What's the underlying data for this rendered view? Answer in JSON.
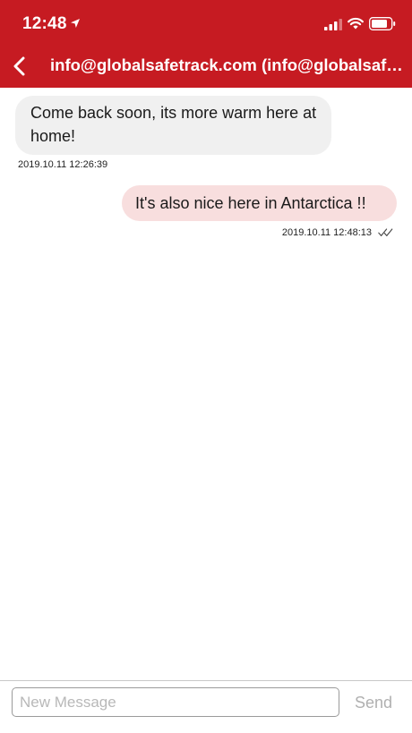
{
  "status_bar": {
    "time": "12:48",
    "location_icon": "location-arrow-icon",
    "signal_icon": "cellular-signal-icon",
    "wifi_icon": "wifi-icon",
    "battery_icon": "battery-icon"
  },
  "header": {
    "title": "info@globalsafetrack.com (info@globalsafetrack.com)",
    "back_icon": "chevron-left-icon",
    "background_color": "#c61b22"
  },
  "messages": [
    {
      "direction": "incoming",
      "text": "Come back soon, its more warm here at home!",
      "timestamp": "2019.10.11 12:26:39",
      "bubble_color": "#f0f0f0"
    },
    {
      "direction": "outgoing",
      "text": "It's also nice here in Antarctica !!",
      "timestamp": "2019.10.11 12:48:13",
      "status_icon": "double-check-icon",
      "bubble_color": "#f8dede"
    }
  ],
  "compose": {
    "placeholder": "New Message",
    "value": "",
    "send_label": "Send"
  }
}
